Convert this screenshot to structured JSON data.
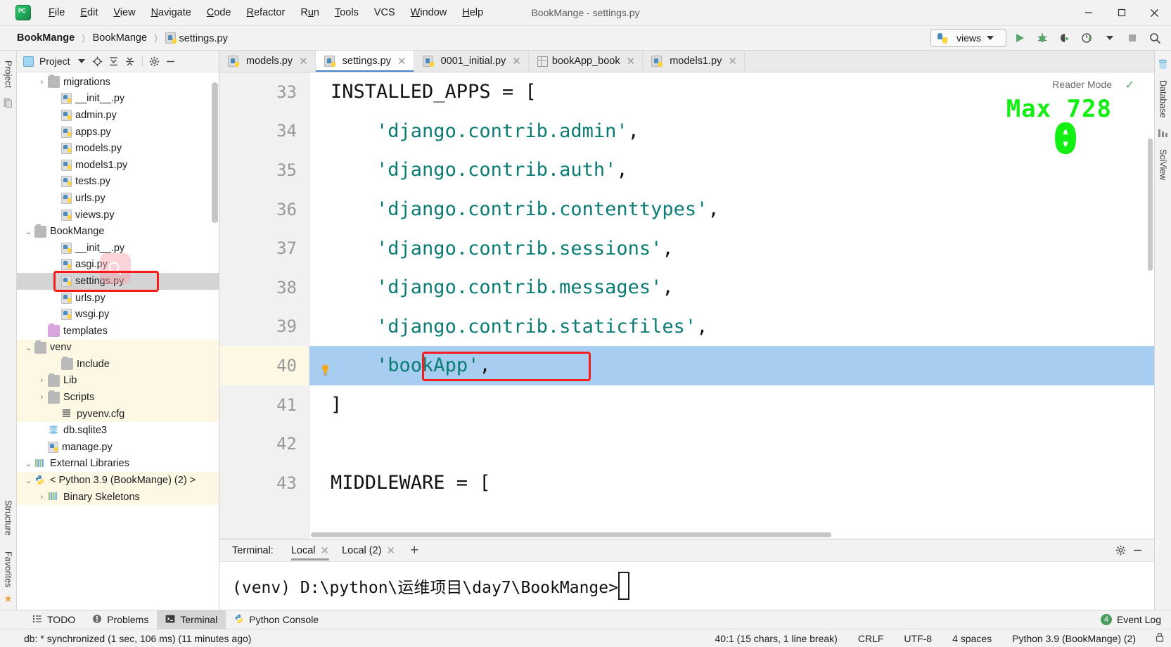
{
  "window": {
    "title": "BookMange - settings.py",
    "app_icon": "pycharm-logo",
    "controls": {
      "minimize": "─",
      "maximize": "☐",
      "close": "✕"
    }
  },
  "menu": [
    {
      "label": "File",
      "mnemonic": "F"
    },
    {
      "label": "Edit",
      "mnemonic": "E"
    },
    {
      "label": "View",
      "mnemonic": "V"
    },
    {
      "label": "Navigate",
      "mnemonic": "N"
    },
    {
      "label": "Code",
      "mnemonic": "C"
    },
    {
      "label": "Refactor",
      "mnemonic": "R"
    },
    {
      "label": "Run",
      "mnemonic": "u"
    },
    {
      "label": "Tools",
      "mnemonic": "T"
    },
    {
      "label": "VCS",
      "mnemonic": ""
    },
    {
      "label": "Window",
      "mnemonic": "W"
    },
    {
      "label": "Help",
      "mnemonic": "H"
    }
  ],
  "breadcrumb": {
    "items": [
      "BookMange",
      "BookMange",
      "settings.py"
    ],
    "separator": "〉"
  },
  "navbar_right": {
    "run_config": "views",
    "run_config_icon": "python-icon",
    "buttons": [
      "run-icon",
      "debug-icon",
      "coverage-icon",
      "profile-icon",
      "stop-icon",
      "search-icon"
    ]
  },
  "left_strip": {
    "top_tabs": [
      "Project"
    ],
    "bottom_tabs": [
      "Structure",
      "Favorites"
    ]
  },
  "right_strip": {
    "tabs": [
      "Database",
      "SciView"
    ]
  },
  "project_panel": {
    "title": "Project",
    "header_icons": [
      "chevron-down-icon",
      "locate-icon",
      "expand-all-icon",
      "collapse-all-icon",
      "gear-icon",
      "hide-icon"
    ],
    "tree": [
      {
        "label": "migrations",
        "indent": 2,
        "twist": "›",
        "icon": "folder",
        "sel": false,
        "excl": false
      },
      {
        "label": "__init__.py",
        "indent": 3,
        "twist": "",
        "icon": "pyfile",
        "sel": false,
        "excl": false
      },
      {
        "label": "admin.py",
        "indent": 3,
        "twist": "",
        "icon": "pyfile",
        "sel": false,
        "excl": false
      },
      {
        "label": "apps.py",
        "indent": 3,
        "twist": "",
        "icon": "pyfile",
        "sel": false,
        "excl": false
      },
      {
        "label": "models.py",
        "indent": 3,
        "twist": "",
        "icon": "pyfile",
        "sel": false,
        "excl": false
      },
      {
        "label": "models1.py",
        "indent": 3,
        "twist": "",
        "icon": "pyfile",
        "sel": false,
        "excl": false
      },
      {
        "label": "tests.py",
        "indent": 3,
        "twist": "",
        "icon": "pyfile",
        "sel": false,
        "excl": false
      },
      {
        "label": "urls.py",
        "indent": 3,
        "twist": "",
        "icon": "pyfile",
        "sel": false,
        "excl": false
      },
      {
        "label": "views.py",
        "indent": 3,
        "twist": "",
        "icon": "pyfile",
        "sel": false,
        "excl": false
      },
      {
        "label": "BookMange",
        "indent": 1,
        "twist": "⌄",
        "icon": "folder",
        "sel": false,
        "excl": false
      },
      {
        "label": "__init__.py",
        "indent": 3,
        "twist": "",
        "icon": "pyfile",
        "sel": false,
        "excl": false
      },
      {
        "label": "asgi.py",
        "indent": 3,
        "twist": "",
        "icon": "pyfile",
        "sel": false,
        "excl": false
      },
      {
        "label": "settings.py",
        "indent": 3,
        "twist": "",
        "icon": "pyfile",
        "sel": true,
        "excl": false
      },
      {
        "label": "urls.py",
        "indent": 3,
        "twist": "",
        "icon": "pyfile",
        "sel": false,
        "excl": false
      },
      {
        "label": "wsgi.py",
        "indent": 3,
        "twist": "",
        "icon": "pyfile",
        "sel": false,
        "excl": false
      },
      {
        "label": "templates",
        "indent": 2,
        "twist": "",
        "icon": "folder-pink",
        "sel": false,
        "excl": false
      },
      {
        "label": "venv",
        "indent": 1,
        "twist": "⌄",
        "icon": "folder",
        "sel": false,
        "excl": true
      },
      {
        "label": "Include",
        "indent": 3,
        "twist": "",
        "icon": "folder",
        "sel": false,
        "excl": true
      },
      {
        "label": "Lib",
        "indent": 2,
        "twist": "›",
        "icon": "folder",
        "sel": false,
        "excl": true
      },
      {
        "label": "Scripts",
        "indent": 2,
        "twist": "›",
        "icon": "folder",
        "sel": false,
        "excl": true
      },
      {
        "label": "pyvenv.cfg",
        "indent": 3,
        "twist": "",
        "icon": "cfgfile",
        "sel": false,
        "excl": true
      },
      {
        "label": "db.sqlite3",
        "indent": 2,
        "twist": "",
        "icon": "dbfile",
        "sel": false,
        "excl": false
      },
      {
        "label": "manage.py",
        "indent": 2,
        "twist": "",
        "icon": "pyfile",
        "sel": false,
        "excl": false
      },
      {
        "label": "External Libraries",
        "indent": 1,
        "twist": "⌄",
        "icon": "libs",
        "sel": false,
        "excl": false
      },
      {
        "label": "< Python 3.9 (BookMange) (2) >",
        "indent": 1,
        "twist": "⌄",
        "icon": "python",
        "sel": false,
        "excl": true
      },
      {
        "label": "Binary Skeletons",
        "indent": 2,
        "twist": "›",
        "icon": "libs",
        "sel": false,
        "excl": true
      }
    ]
  },
  "editor_tabs": [
    {
      "label": "models.py",
      "icon": "python-file-icon",
      "active": false
    },
    {
      "label": "settings.py",
      "icon": "python-file-icon",
      "active": true
    },
    {
      "label": "0001_initial.py",
      "icon": "python-file-icon",
      "active": false
    },
    {
      "label": "bookApp_book",
      "icon": "table-icon",
      "active": false
    },
    {
      "label": "models1.py",
      "icon": "python-file-icon",
      "active": false
    }
  ],
  "editor": {
    "reader_mode_label": "Reader Mode",
    "watermark_text": "Max 728",
    "watermark_zero": "0",
    "watermark_color": "#13ef13",
    "lines": [
      {
        "num": "33",
        "text": "INSTALLED_APPS = [",
        "kind": "code",
        "fold": true,
        "selected": false,
        "bulb": false
      },
      {
        "num": "34",
        "text": "    'django.contrib.admin',",
        "kind": "string",
        "fold": false,
        "selected": false,
        "bulb": false
      },
      {
        "num": "35",
        "text": "    'django.contrib.auth',",
        "kind": "string",
        "fold": false,
        "selected": false,
        "bulb": false
      },
      {
        "num": "36",
        "text": "    'django.contrib.contenttypes',",
        "kind": "string",
        "fold": false,
        "selected": false,
        "bulb": false
      },
      {
        "num": "37",
        "text": "    'django.contrib.sessions',",
        "kind": "string",
        "fold": false,
        "selected": false,
        "bulb": false
      },
      {
        "num": "38",
        "text": "    'django.contrib.messages',",
        "kind": "string",
        "fold": false,
        "selected": false,
        "bulb": false
      },
      {
        "num": "39",
        "text": "    'django.contrib.staticfiles',",
        "kind": "string",
        "fold": false,
        "selected": false,
        "bulb": false
      },
      {
        "num": "40",
        "text": "    'bookApp',",
        "kind": "string",
        "fold": false,
        "selected": true,
        "bulb": true
      },
      {
        "num": "41",
        "text": "]",
        "kind": "code",
        "fold": true,
        "selected": false,
        "bulb": false
      },
      {
        "num": "42",
        "text": "",
        "kind": "code",
        "fold": false,
        "selected": false,
        "bulb": false
      },
      {
        "num": "43",
        "text": "MIDDLEWARE = [",
        "kind": "code",
        "fold": true,
        "selected": false,
        "bulb": false
      }
    ]
  },
  "terminal": {
    "label": "Terminal:",
    "tabs": [
      {
        "label": "Local",
        "active": true
      },
      {
        "label": "Local (2)",
        "active": false
      }
    ],
    "add_tab": "+",
    "prompt": "(venv) D:\\python\\运维项目\\day7\\BookMange>"
  },
  "tool_windows": [
    {
      "label": "TODO",
      "icon": "todo-icon",
      "active": false
    },
    {
      "label": "Problems",
      "icon": "problems-icon",
      "active": false
    },
    {
      "label": "Terminal",
      "icon": "terminal-icon",
      "active": true
    },
    {
      "label": "Python Console",
      "icon": "python-icon",
      "active": false
    }
  ],
  "event_log": {
    "label": "Event Log",
    "count": "4"
  },
  "statusbar": {
    "message": "db: * synchronized (1 sec, 106 ms) (11 minutes ago)",
    "caret": "40:1 (15 chars, 1 line break)",
    "line_separator": "CRLF",
    "encoding": "UTF-8",
    "indent": "4 spaces",
    "interpreter": "Python 3.9 (BookMange) (2)",
    "lock_icon": "lock-icon"
  }
}
